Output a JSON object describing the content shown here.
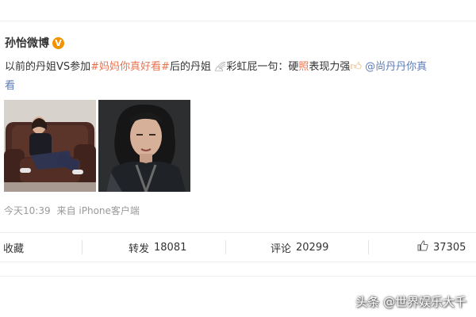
{
  "post": {
    "author": "孙怡微博",
    "verified_badge": "V",
    "text": {
      "p1": "以前的丹姐VS参加",
      "hashtag": "#妈妈你真好看#",
      "p2": "后的丹姐 ",
      "p3": "彩虹屁一句：硬",
      "highlight": "照",
      "p4": "表现力强",
      "mention": "@尚丹丹你真",
      "p5": "看"
    },
    "meta": {
      "time": "今天10:39",
      "source": "来自 iPhone客户端"
    }
  },
  "actions": {
    "favorite": "收藏",
    "repost_label": "转发",
    "repost_count": "18081",
    "comment_label": "评论",
    "comment_count": "20299",
    "like_count": "37305"
  },
  "watermark": "头条 @世界娱乐大千",
  "colors": {
    "hashtag": "#eb7350",
    "link": "#5d7bb8",
    "badge": "#f29200"
  }
}
